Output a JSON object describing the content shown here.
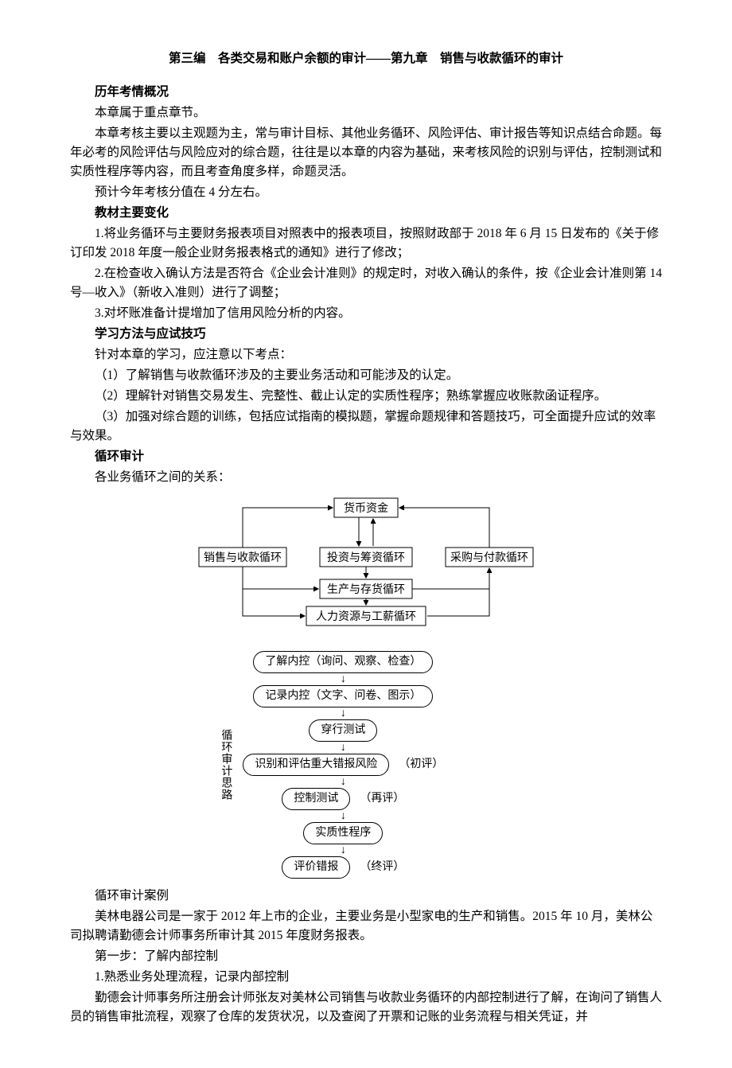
{
  "title": "第三编　各类交易和账户余额的审计——第九章　销售与收款循环的审计",
  "h1": "历年考情概况",
  "p1": "本章属于重点章节。",
  "p2": "本章考核主要以主观题为主，常与审计目标、其他业务循环、风险评估、审计报告等知识点结合命题。每年必考的风险评估与风险应对的综合题，往往是以本章的内容为基础，来考核风险的识别与评估，控制测试和实质性程序等内容，而且考查角度多样，命题灵活。",
  "p3": "预计今年考核分值在 4 分左右。",
  "h2": "教材主要变化",
  "p4": "1.将业务循环与主要财务报表项目对照表中的报表项目，按照财政部于 2018 年 6 月 15 日发布的《关于修订印发 2018 年度一般企业财务报表格式的通知》进行了修改；",
  "p5": "2.在检查收入确认方法是否符合《企业会计准则》的规定时，对收入确认的条件，按《企业会计准则第 14 号—收入》（新收入准则）进行了调整；",
  "p6": "3.对坏账准备计提增加了信用风险分析的内容。",
  "h3": "学习方法与应试技巧",
  "p7": "针对本章的学习，应注意以下考点：",
  "p8": "（1）了解销售与收款循环涉及的主要业务活动和可能涉及的认定。",
  "p9": "（2）理解针对销售交易发生、完整性、截止认定的实质性程序；熟练掌握应收账款函证程序。",
  "p10": "（3）加强对综合题的训练，包括应试指南的模拟题，掌握命题规律和答题技巧，可全面提升应试的效率与效果。",
  "h4": "循环审计",
  "p11": "各业务循环之间的关系：",
  "diagram1": {
    "top": "货币资金",
    "left": "销售与收款循环",
    "midTop": "投资与筹资循环",
    "right": "采购与付款循环",
    "midBot1": "生产与存货循环",
    "midBot2": "人力资源与工薪循环"
  },
  "flow2": {
    "sideLabel": "循环审计思路",
    "steps": [
      {
        "text": "了解内控（询问、观察、检查）",
        "note": ""
      },
      {
        "text": "记录内控（文字、问卷、图示）",
        "note": ""
      },
      {
        "text": "穿行测试",
        "note": ""
      },
      {
        "text": "识别和评估重大错报风险",
        "note": "（初评）"
      },
      {
        "text": "控制测试",
        "note": "（再评）"
      },
      {
        "text": "实质性程序",
        "note": ""
      },
      {
        "text": "评价错报",
        "note": "（终评）"
      }
    ]
  },
  "p12": "循环审计案例",
  "p13": "美林电器公司是一家于 2012 年上市的企业，主要业务是小型家电的生产和销售。2015 年 10 月，美林公司拟聘请勤德会计师事务所审计其 2015 年度财务报表。",
  "p14": "第一步：了解内部控制",
  "p15": "1.熟悉业务处理流程，记录内部控制",
  "p16": "勤德会计师事务所注册会计师张友对美林公司销售与收款业务循环的内部控制进行了解，在询问了销售人员的销售审批流程，观察了仓库的发货状况，以及查阅了开票和记账的业务流程与相关凭证，并"
}
